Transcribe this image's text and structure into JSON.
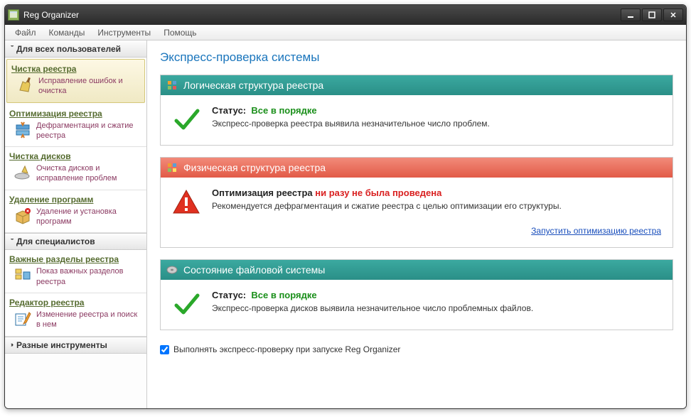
{
  "window": {
    "title": "Reg Organizer"
  },
  "menu": [
    "Файл",
    "Команды",
    "Инструменты",
    "Помощь"
  ],
  "sidebar": {
    "section_users": "Для всех пользователей",
    "section_pros": "Для специалистов",
    "section_tools": "Разные инструменты",
    "groups": [
      {
        "title": "Чистка реестра",
        "desc": "Исправление ошибок и очистка"
      },
      {
        "title": "Оптимизация реестра",
        "desc": "Дефрагментация и сжатие реестра"
      },
      {
        "title": "Чистка дисков",
        "desc": "Очистка дисков и исправление проблем"
      },
      {
        "title": "Удаление программ",
        "desc": "Удаление и установка программ"
      }
    ],
    "pro_groups": [
      {
        "title": "Важные разделы реестра",
        "desc": "Показ важных разделов реестра"
      },
      {
        "title": "Редактор реестра",
        "desc": "Изменение реестра и поиск в нем"
      }
    ]
  },
  "main": {
    "title": "Экспресс-проверка системы",
    "cards": [
      {
        "header": "Логическая структура реестра",
        "status_label": "Статус:",
        "status_value": "Все в порядке",
        "desc": "Экспресс-проверка реестра выявила незначительное число проблем."
      },
      {
        "header": "Физическая структура реестра",
        "status_label": "Оптимизация реестра",
        "status_value": "ни разу не была проведена",
        "desc": "Рекомендуется дефрагментация и сжатие реестра с целью оптимизации его структуры.",
        "action": "Запустить оптимизацию реестра"
      },
      {
        "header": "Состояние файловой системы",
        "status_label": "Статус:",
        "status_value": "Все в порядке",
        "desc": "Экспресс-проверка дисков выявила незначительное число проблемных файлов."
      }
    ],
    "footer_option": "Выполнять экспресс-проверку при запуске Reg Organizer"
  }
}
